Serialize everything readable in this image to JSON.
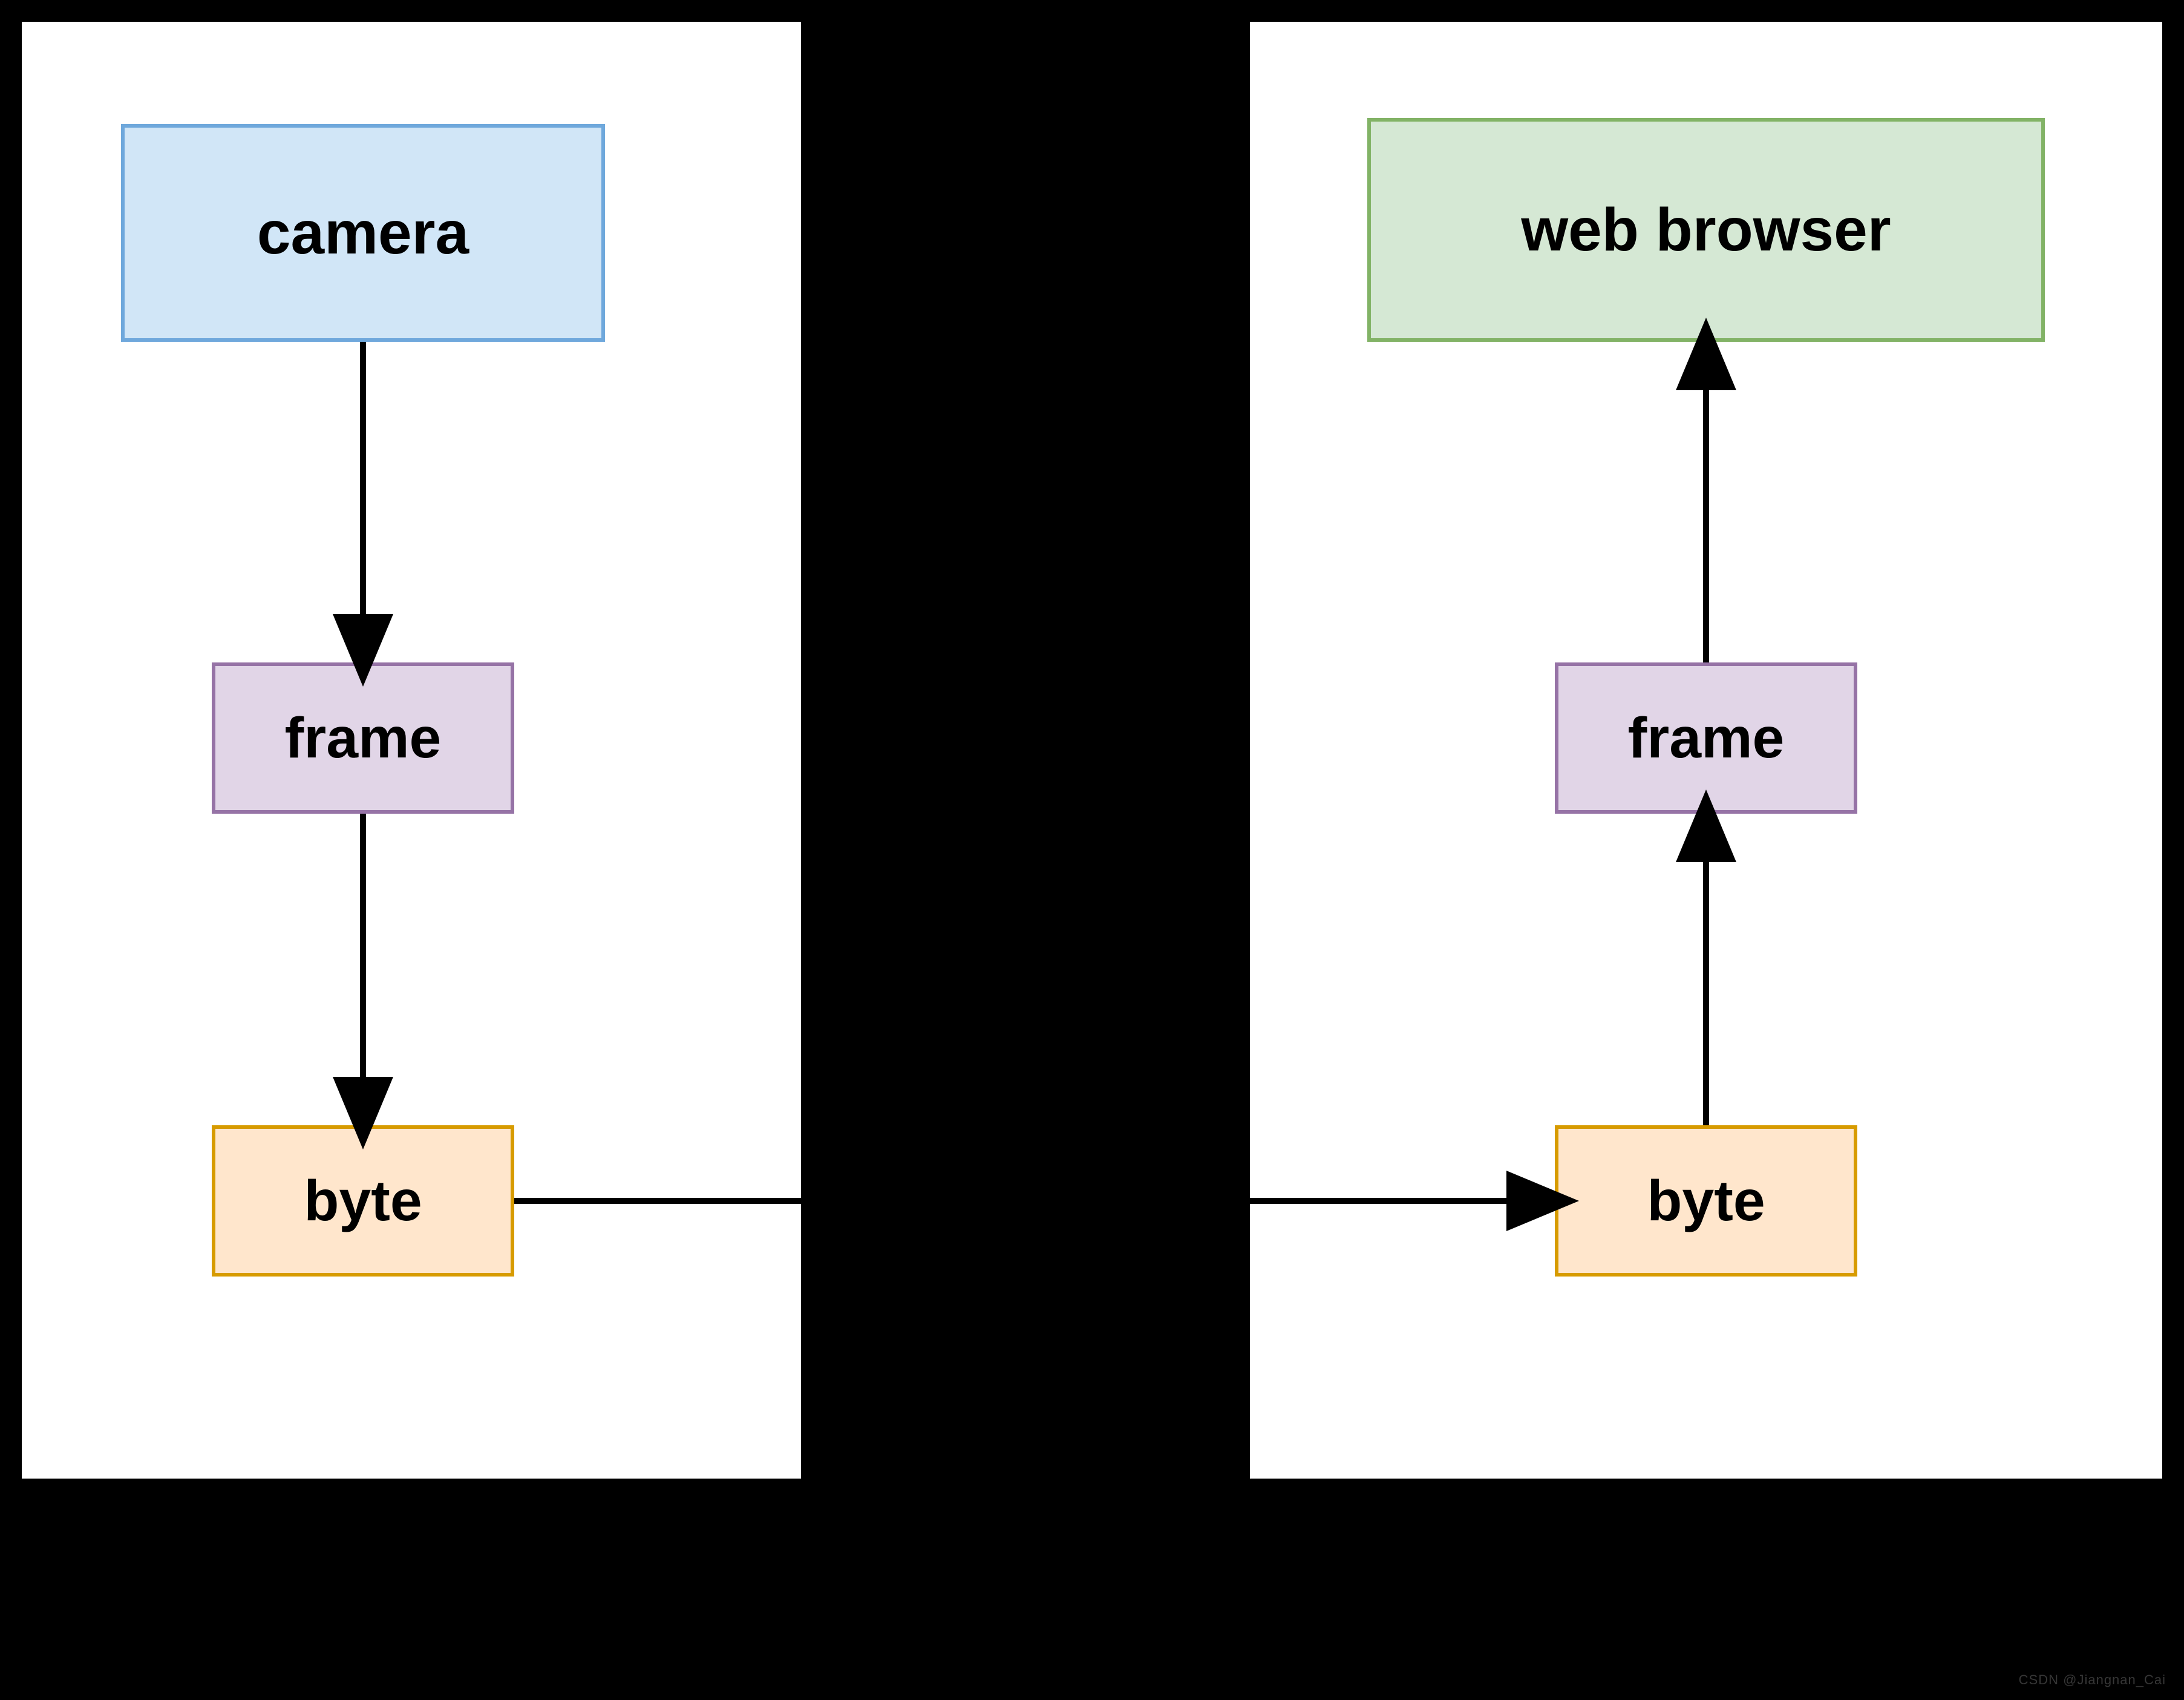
{
  "left_panel": {
    "nodes": {
      "camera": {
        "label": "camera"
      },
      "frame": {
        "label": "frame"
      },
      "byte": {
        "label": "byte"
      }
    }
  },
  "right_panel": {
    "nodes": {
      "browser": {
        "label": "web browser"
      },
      "frame": {
        "label": "frame"
      },
      "byte": {
        "label": "byte"
      }
    }
  },
  "watermark": "CSDN @Jiangnan_Cai",
  "colors": {
    "camera_fill": "#D1E6F7",
    "camera_border": "#6FA8DC",
    "browser_fill": "#D5E8D4",
    "browser_border": "#82B366",
    "frame_fill": "#E1D5E7",
    "frame_border": "#9673A6",
    "byte_fill": "#FFE6CC",
    "byte_border": "#D79B00",
    "panel_bg": "#FFFFFF",
    "page_bg": "#000000",
    "arrow": "#000000"
  },
  "flow": {
    "description": "camera → frame → byte → (transfer) → byte → frame → web browser",
    "edges": [
      {
        "from": "left.camera",
        "to": "left.frame",
        "dir": "down"
      },
      {
        "from": "left.frame",
        "to": "left.byte",
        "dir": "down"
      },
      {
        "from": "left.byte",
        "to": "right.byte",
        "dir": "right"
      },
      {
        "from": "right.byte",
        "to": "right.frame",
        "dir": "up"
      },
      {
        "from": "right.frame",
        "to": "right.browser",
        "dir": "up"
      }
    ]
  }
}
